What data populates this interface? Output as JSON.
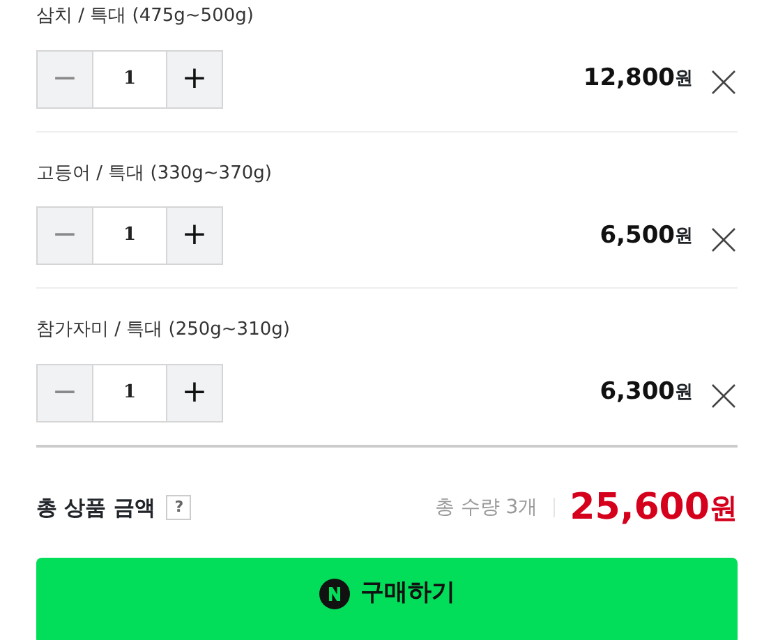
{
  "items": [
    {
      "name": "삼치 / 특대 (475g~500g)",
      "minus": "−",
      "minus_disabled": true,
      "quantity": "1",
      "plus": "+",
      "price": "12,800",
      "unit": "원"
    },
    {
      "name": "고등어 / 특대 (330g~370g)",
      "minus": "−",
      "minus_disabled": true,
      "quantity": "1",
      "plus": "+",
      "price": "6,500",
      "unit": "원"
    },
    {
      "name": "참가자미 / 특대 (250g~310g)",
      "minus": "−",
      "minus_disabled": true,
      "quantity": "1",
      "plus": "+",
      "price": "6,300",
      "unit": "원"
    }
  ],
  "total": {
    "label": "총 상품 금액",
    "help": "?",
    "count": "총 수량 3개",
    "amount": "25,600",
    "unit": "원"
  },
  "buy_button": {
    "label": "구매하기"
  }
}
